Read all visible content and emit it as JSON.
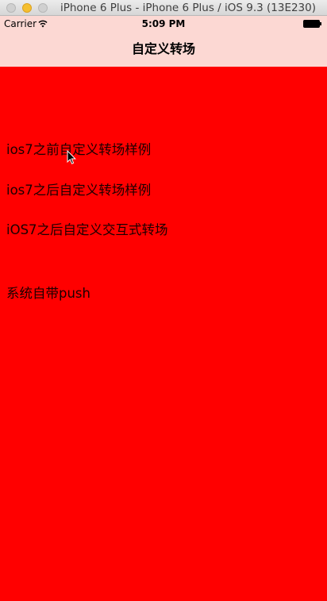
{
  "window": {
    "title": "iPhone 6 Plus - iPhone 6 Plus / iOS 9.3 (13E230)"
  },
  "statusbar": {
    "carrier": "Carrier",
    "time": "5:09 PM",
    "wifi_icon": "wifi-icon",
    "battery_icon": "battery-icon"
  },
  "navbar": {
    "title": "自定义转场"
  },
  "menu": {
    "items": [
      {
        "label": "ios7之前自定义转场样例"
      },
      {
        "label": "ios7之后自定义转场样例"
      },
      {
        "label": "iOS7之后自定义交互式转场"
      },
      {
        "label": "系统自带push"
      }
    ]
  },
  "colors": {
    "content_background": "#ff0000",
    "bar_background": "#fcd8d3"
  }
}
